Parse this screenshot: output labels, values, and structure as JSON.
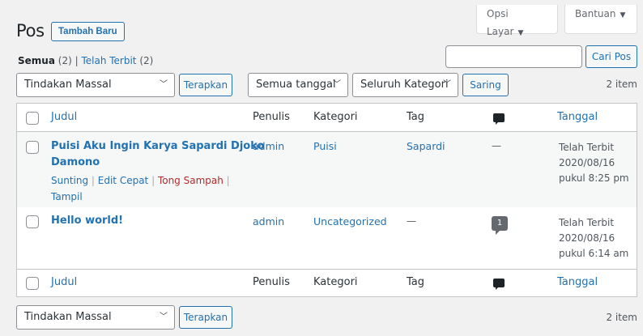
{
  "header": {
    "title": "Pos",
    "add_new": "Tambah Baru",
    "screen_options": "Opsi Layar",
    "help": "Bantuan"
  },
  "views": {
    "all_label": "Semua",
    "all_count": "(2)",
    "sep": "|",
    "published_label": "Telah Terbit",
    "published_count": "(2)"
  },
  "search": {
    "value": "",
    "button": "Cari Pos"
  },
  "tablenav_top": {
    "bulk_action": "Tindakan Massal",
    "apply": "Terapkan",
    "date_filter": "Semua tanggal",
    "category_filter": "Seluruh Kategori",
    "filter_button": "Saring",
    "items": "2 item"
  },
  "table": {
    "columns": {
      "title": "Judul",
      "author": "Penulis",
      "categories": "Kategori",
      "tags": "Tag",
      "date": "Tanggal"
    },
    "rows": [
      {
        "title_line1": "Puisi Aku Ingin Karya Sapardi Djoko",
        "title_line2": "Damono",
        "actions": {
          "edit": "Sunting",
          "quick_edit": "Edit Cepat",
          "trash": "Tong Sampah",
          "view": "Tampil"
        },
        "author": "admin",
        "category": "Puisi",
        "tag": "Sapardi",
        "comments": "—",
        "status": "Telah Terbit",
        "date": "2020/08/16",
        "time": "pukul 8:25 pm"
      },
      {
        "title_line1": "Hello world!",
        "author": "admin",
        "category": "Uncategorized",
        "tag": "—",
        "comments": "1",
        "status": "Telah Terbit",
        "date": "2020/08/16",
        "time": "pukul 6:14 am"
      }
    ]
  },
  "tablenav_bottom": {
    "bulk_action": "Tindakan Massal",
    "apply": "Terapkan",
    "items": "2 item"
  },
  "colors": {
    "link": "#2271b1",
    "trash": "#b32d2e",
    "background": "#f1f1f1"
  }
}
